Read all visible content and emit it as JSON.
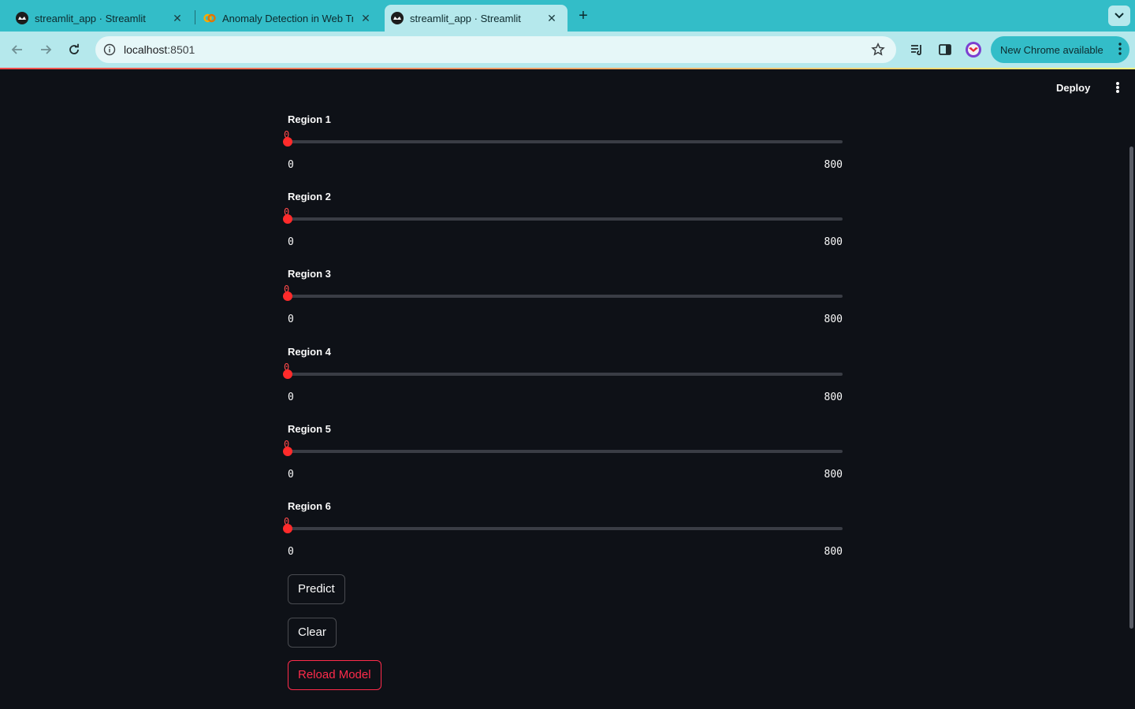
{
  "browser": {
    "tabs": [
      {
        "title": "streamlit_app · Streamlit",
        "icon": "streamlit-icon",
        "active": false
      },
      {
        "title": "Anomaly Detection in Web Tr",
        "icon": "colab-icon",
        "active": false
      },
      {
        "title": "streamlit_app · Streamlit",
        "icon": "streamlit-icon",
        "active": true
      }
    ],
    "url_host": "localhost",
    "url_port": ":8501",
    "update_label": "New Chrome available"
  },
  "app": {
    "deploy_label": "Deploy",
    "accent": "#ff4b4b",
    "sliders": [
      {
        "label": "Region 1",
        "value": "0",
        "min": "0",
        "max": "800"
      },
      {
        "label": "Region 2",
        "value": "0",
        "min": "0",
        "max": "800"
      },
      {
        "label": "Region 3",
        "value": "0",
        "min": "0",
        "max": "800"
      },
      {
        "label": "Region 4",
        "value": "0",
        "min": "0",
        "max": "800"
      },
      {
        "label": "Region 5",
        "value": "0",
        "min": "0",
        "max": "800"
      },
      {
        "label": "Region 6",
        "value": "0",
        "min": "0",
        "max": "800"
      }
    ],
    "buttons": {
      "predict": "Predict",
      "clear": "Clear",
      "reload": "Reload Model"
    }
  }
}
